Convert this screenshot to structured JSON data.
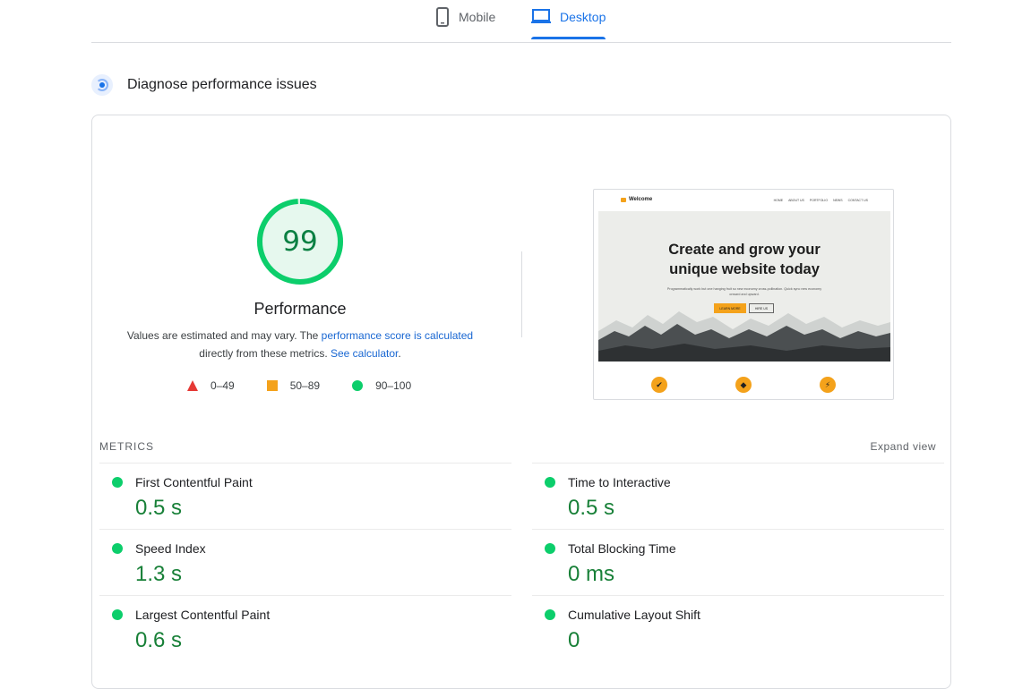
{
  "tabs": [
    {
      "label": "Mobile",
      "icon": "phone-icon",
      "active": false
    },
    {
      "label": "Desktop",
      "icon": "laptop-icon",
      "active": true
    }
  ],
  "diagnose": {
    "title": "Diagnose performance issues"
  },
  "performance": {
    "score": "99",
    "score_fraction": 0.99,
    "title": "Performance",
    "note_prefix": "Values are estimated and may vary. The ",
    "note_link1": "performance score is calculated",
    "note_mid": " directly from these metrics. ",
    "note_link2": "See calculator",
    "note_suffix": ".",
    "colors": {
      "pass": "#0cce6b",
      "average": "#f4a21b",
      "fail": "#e53935"
    }
  },
  "legend": [
    {
      "range": "0–49",
      "icon": "red-triangle"
    },
    {
      "range": "50–89",
      "icon": "orange-square"
    },
    {
      "range": "90–100",
      "icon": "green-circle"
    }
  ],
  "screenshot": {
    "logo": "Welcome",
    "menu": [
      "HOME",
      "ABOUT US",
      "PORTFOLIO",
      "NEWS",
      "CONTACT US"
    ],
    "headline_line1": "Create and grow your",
    "headline_line2": "unique website today",
    "subtext": "Programmatically work but one hanging fruit so new economy cross-pollination. Quick sync new economy onward and upward.",
    "btn_primary": "LEARN MORE",
    "btn_secondary": "HIRE US",
    "features": [
      "check-icon",
      "gem-icon",
      "bolt-icon"
    ]
  },
  "metrics": {
    "header": "METRICS",
    "expand_label": "Expand view",
    "left": [
      {
        "name": "First Contentful Paint",
        "value": "0.5 s"
      },
      {
        "name": "Speed Index",
        "value": "1.3 s"
      },
      {
        "name": "Largest Contentful Paint",
        "value": "0.6 s"
      }
    ],
    "right": [
      {
        "name": "Time to Interactive",
        "value": "0.5 s"
      },
      {
        "name": "Total Blocking Time",
        "value": "0 ms"
      },
      {
        "name": "Cumulative Layout Shift",
        "value": "0"
      }
    ]
  }
}
